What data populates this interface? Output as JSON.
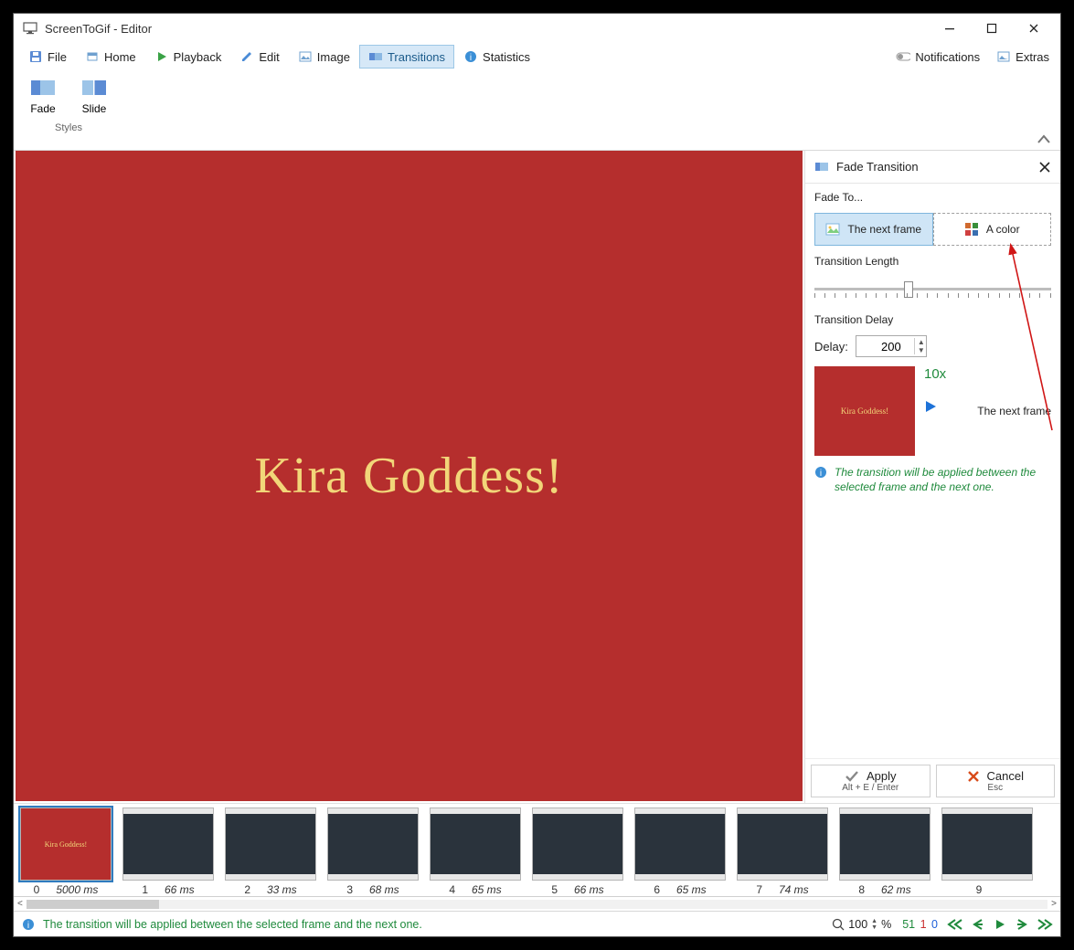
{
  "window": {
    "title": "ScreenToGif - Editor"
  },
  "tabs": {
    "file": "File",
    "home": "Home",
    "playback": "Playback",
    "edit": "Edit",
    "image": "Image",
    "transitions": "Transitions",
    "statistics": "Statistics",
    "notifications": "Notifications",
    "extras": "Extras"
  },
  "ribbon": {
    "fade": "Fade",
    "slide": "Slide",
    "group": "Styles"
  },
  "canvas": {
    "text": "Kira Goddess!"
  },
  "panel": {
    "title": "Fade Transition",
    "fade_to": "Fade To...",
    "opt_next": "The next frame",
    "opt_color": "A color",
    "len_label": "Transition Length",
    "delay_section": "Transition Delay",
    "delay_label": "Delay:",
    "delay_value": "200",
    "count": "10x",
    "next_frame": "The next frame",
    "preview_text": "Kira Goddess!",
    "info": "The transition will be applied between the selected frame and the next one.",
    "apply": "Apply",
    "apply_hint": "Alt + E / Enter",
    "cancel": "Cancel",
    "cancel_hint": "Esc"
  },
  "timeline": {
    "items": [
      {
        "idx": "0",
        "ms": "5000 ms",
        "first": true,
        "text": "Kira Goddess!"
      },
      {
        "idx": "1",
        "ms": "66 ms"
      },
      {
        "idx": "2",
        "ms": "33 ms"
      },
      {
        "idx": "3",
        "ms": "68 ms"
      },
      {
        "idx": "4",
        "ms": "65 ms"
      },
      {
        "idx": "5",
        "ms": "66 ms"
      },
      {
        "idx": "6",
        "ms": "65 ms"
      },
      {
        "idx": "7",
        "ms": "74 ms"
      },
      {
        "idx": "8",
        "ms": "62 ms"
      },
      {
        "idx": "9",
        "ms": ""
      }
    ]
  },
  "status": {
    "msg": "The transition will be applied between the selected frame and the next one.",
    "zoom": "100",
    "pct": "%",
    "c_green": "51",
    "c_red": "1",
    "c_blue": "0"
  }
}
